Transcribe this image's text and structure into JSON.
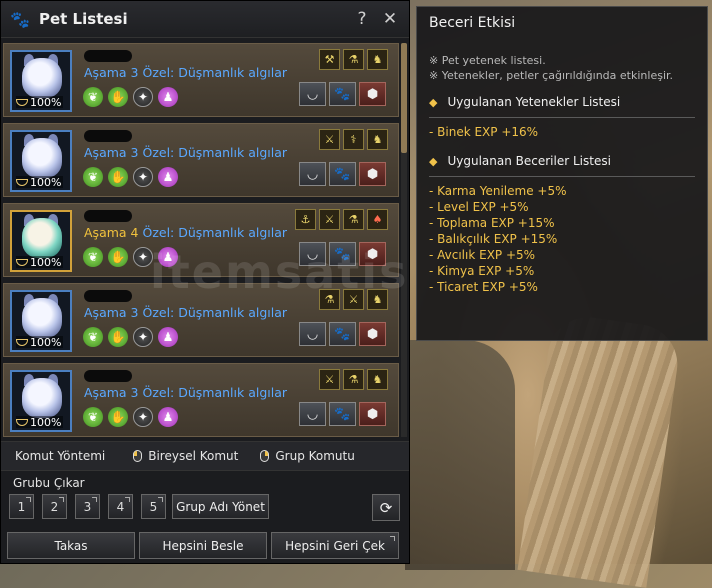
{
  "window": {
    "title": "Pet Listesi",
    "help_label": "?",
    "close_label": "✕"
  },
  "pets": [
    {
      "level": "100%",
      "stage_label": "Aşama 3",
      "special_label": "Özel: Düşmanlık algılar",
      "tier": "blue",
      "abilities": [
        "⚒",
        "⚗",
        "♞"
      ]
    },
    {
      "level": "100%",
      "stage_label": "Aşama 3",
      "special_label": "Özel: Düşmanlık algılar",
      "tier": "blue",
      "abilities": [
        "⚔",
        "⚕",
        "♞"
      ]
    },
    {
      "level": "100%",
      "stage_label": "Aşama 4",
      "special_label": "Özel: Düşmanlık algılar",
      "tier": "gold",
      "abilities": [
        "⚓",
        "⚔",
        "⚗",
        "♠"
      ]
    },
    {
      "level": "100%",
      "stage_label": "Aşama 3",
      "special_label": "Özel: Düşmanlık algılar",
      "tier": "blue",
      "abilities": [
        "⚗",
        "⚔",
        "♞"
      ]
    },
    {
      "level": "100%",
      "stage_label": "Aşama 3",
      "special_label": "Özel: Düşmanlık algılar",
      "tier": "blue",
      "abilities": [
        "⚔",
        "⚗",
        "♞"
      ]
    }
  ],
  "command_row": {
    "method_label": "Komut Yöntemi",
    "individual_label": "Bireysel Komut",
    "group_label": "Grup Komutu"
  },
  "groups": {
    "label": "Grubu Çıkar",
    "numbers": [
      "1",
      "2",
      "3",
      "4",
      "5"
    ],
    "manage_label": "Grup Adı Yönet"
  },
  "bottom_buttons": {
    "exchange_label": "Takas",
    "feed_all_label": "Hepsini Besle",
    "recall_all_label": "Hepsini Geri Çek"
  },
  "tooltip": {
    "title": "Beceri Etkisi",
    "notes": [
      "※ Pet yetenek listesi.",
      "※ Yetenekler, petler çağırıldığında etkinleşir."
    ],
    "applied_skills_header": "Uygulanan Yetenekler Listesi",
    "applied_skills": [
      "- Binek EXP +16%"
    ],
    "applied_abilities_header": "Uygulanan Beceriler Listesi",
    "applied_abilities": [
      "- Karma Yenileme +5%",
      "- Level EXP +5%",
      "- Toplama EXP +15%",
      "- Balıkçılık EXP +15%",
      "- Avcılık EXP +5%",
      "- Kimya EXP +5%",
      "- Ticaret EXP +5%"
    ]
  },
  "watermark": "itemsatis",
  "colors": {
    "stage_blue": "#5aa8ff",
    "stage_gold": "#f1c23d",
    "bonus_gold": "#f0c24a"
  }
}
